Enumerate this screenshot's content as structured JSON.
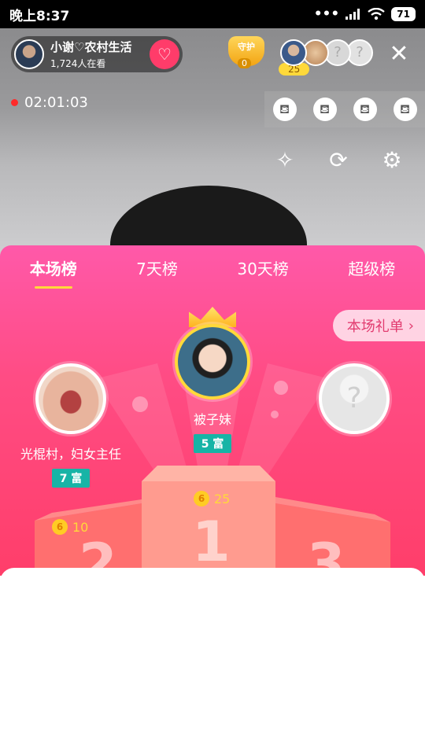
{
  "status": {
    "time": "晚上8:37",
    "battery": "71"
  },
  "host": {
    "name": "小谢♡农村生活",
    "viewers": "1,724人在看"
  },
  "guard": {
    "label": "守护",
    "count": "0"
  },
  "viewer_rank_count": "25",
  "live_timer": "02:01:03",
  "tabs": [
    {
      "label": "本场榜",
      "active": true
    },
    {
      "label": "7天榜",
      "active": false
    },
    {
      "label": "30天榜",
      "active": false
    },
    {
      "label": "超级榜",
      "active": false
    }
  ],
  "gift_list_button": "本场礼单",
  "ranking": {
    "first": {
      "name": "被子妹",
      "rich_level": "5 富",
      "coins": "25"
    },
    "second": {
      "name": "光棍村，妇女主任",
      "rich_level": "7 富",
      "coins": "10"
    },
    "third": {
      "name": "",
      "rich_level": "",
      "coins": ""
    },
    "podium_numbers": [
      "1",
      "2",
      "3"
    ]
  },
  "coin_glyph": "6",
  "colors": {
    "panel_top": "#ff59a9",
    "panel_bottom": "#ff3e6a",
    "accent_yellow": "#ffd93a",
    "rich_badge": "#17b4a6"
  }
}
